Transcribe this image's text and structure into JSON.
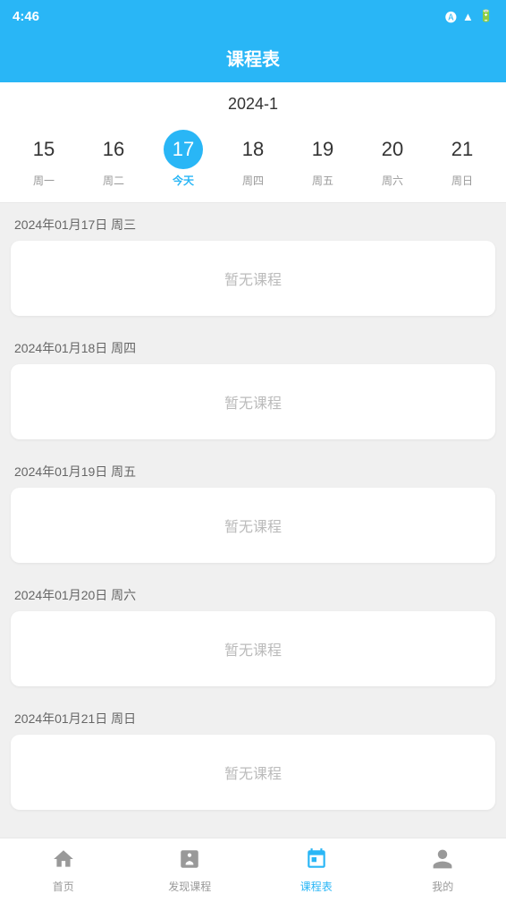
{
  "statusBar": {
    "time": "4:46",
    "icons": [
      "A",
      "wifi",
      "battery"
    ]
  },
  "header": {
    "title": "课程表"
  },
  "yearWeek": "2024-1",
  "days": [
    {
      "number": "15",
      "label": "周一",
      "isToday": false
    },
    {
      "number": "16",
      "label": "周二",
      "isToday": false
    },
    {
      "number": "17",
      "label": "今天",
      "isToday": true
    },
    {
      "number": "18",
      "label": "周四",
      "isToday": false
    },
    {
      "number": "19",
      "label": "周五",
      "isToday": false
    },
    {
      "number": "20",
      "label": "周六",
      "isToday": false
    },
    {
      "number": "21",
      "label": "周日",
      "isToday": false
    }
  ],
  "sections": [
    {
      "date": "2024年01月17日 周三",
      "noCourse": "暂无课程"
    },
    {
      "date": "2024年01月18日 周四",
      "noCourse": "暂无课程"
    },
    {
      "date": "2024年01月19日 周五",
      "noCourse": "暂无课程"
    },
    {
      "date": "2024年01月20日 周六",
      "noCourse": "暂无课程"
    },
    {
      "date": "2024年01月21日 周日",
      "noCourse": "暂无课程"
    }
  ],
  "bottomNav": [
    {
      "label": "首页",
      "icon": "home",
      "active": false
    },
    {
      "label": "发现课程",
      "icon": "discover",
      "active": false
    },
    {
      "label": "课程表",
      "icon": "schedule",
      "active": true
    },
    {
      "label": "我的",
      "icon": "profile",
      "active": false
    }
  ]
}
